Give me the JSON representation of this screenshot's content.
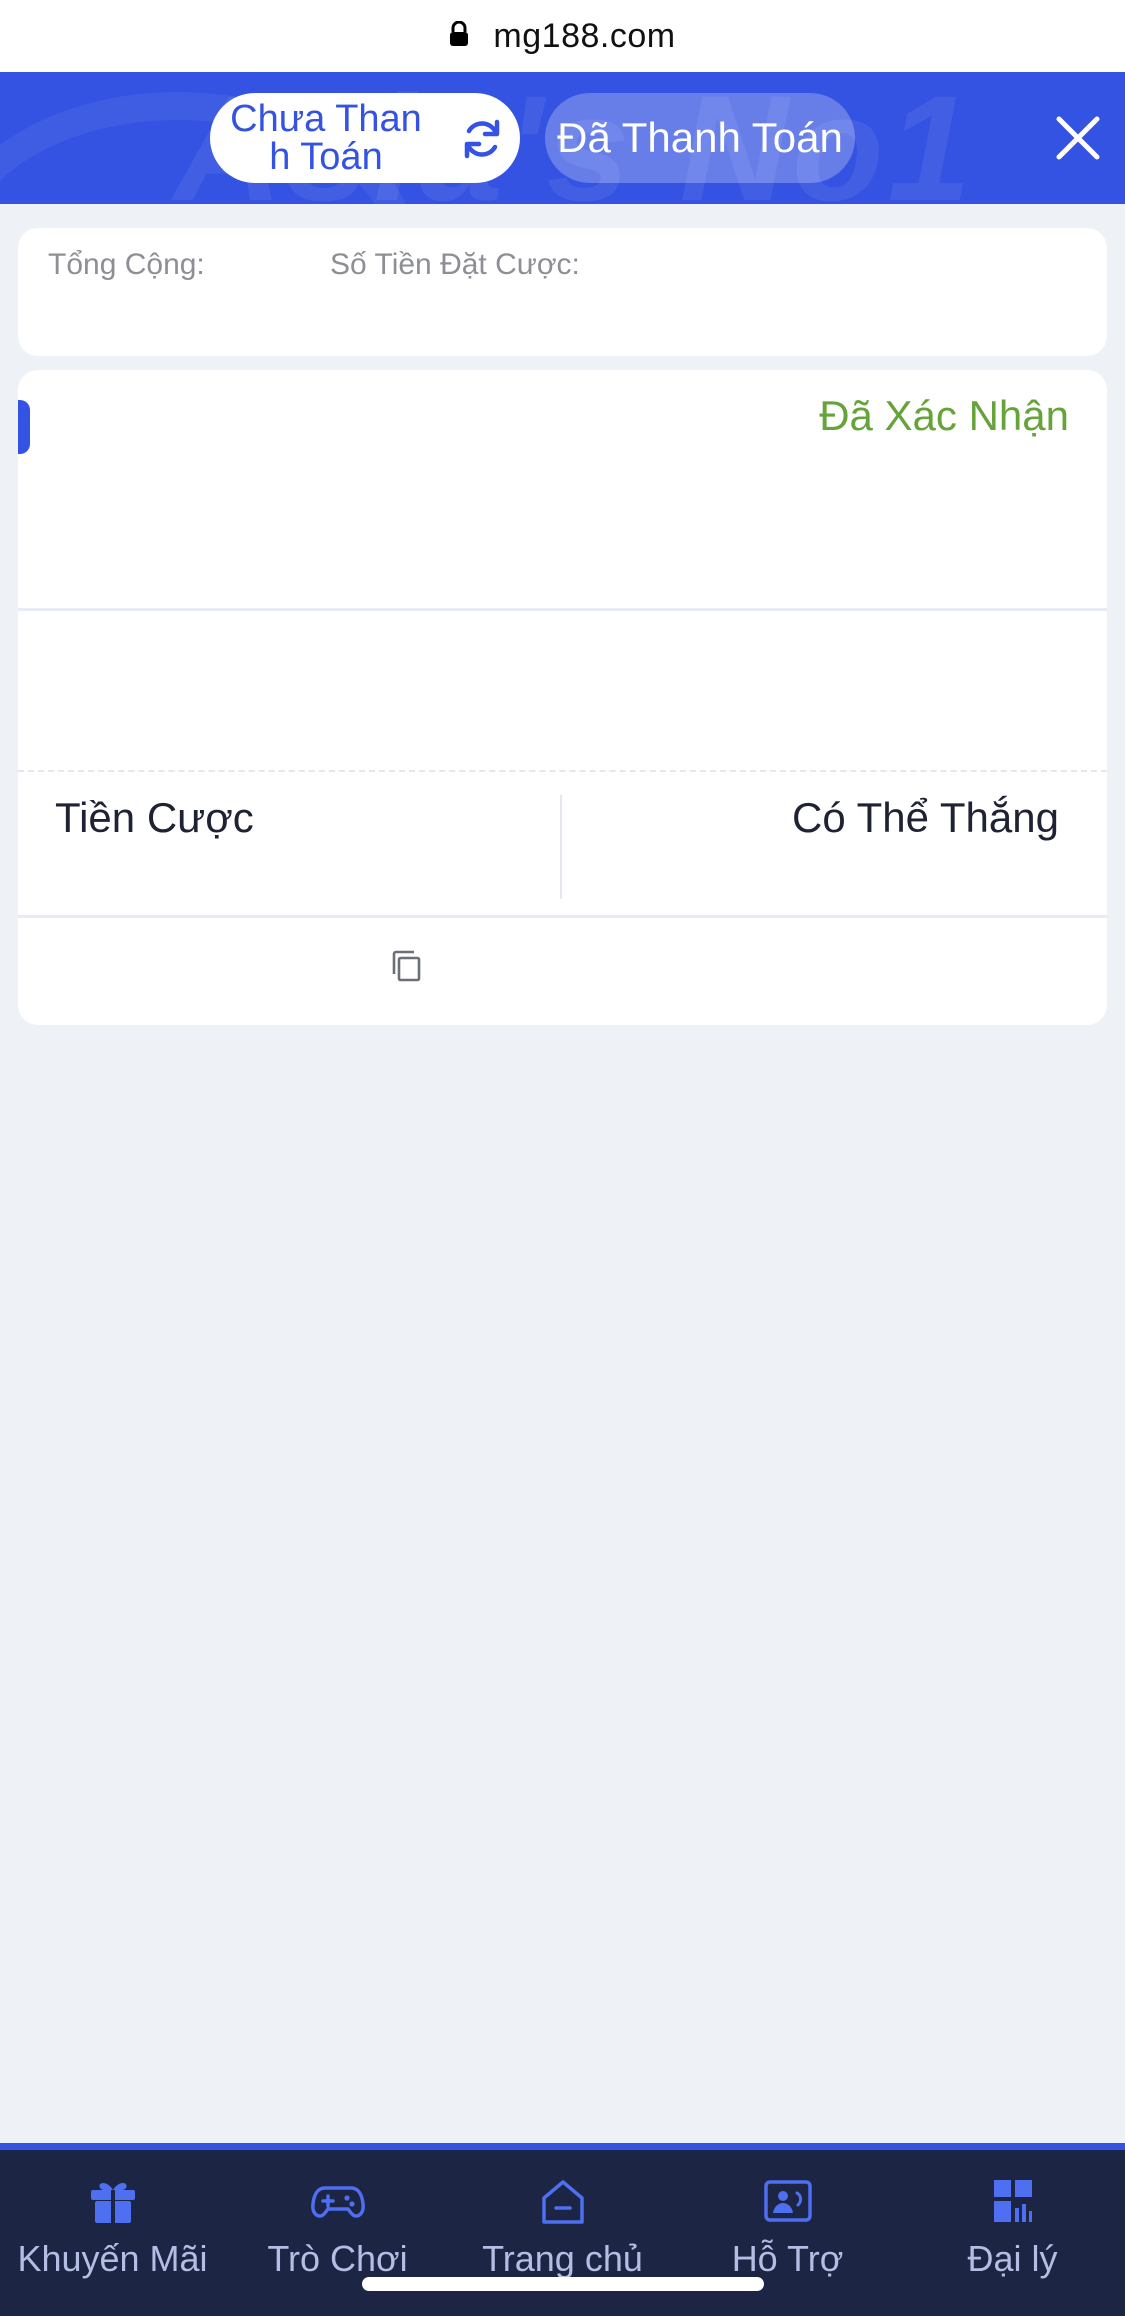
{
  "browser": {
    "url": "mg188.com"
  },
  "header": {
    "tab_unpaid": "Chưa Thanh Toán",
    "tab_paid": "Đã Thanh Toán",
    "decor_text": "Asia's No1",
    "accent_color": "#3453e2"
  },
  "summary": {
    "total_label": "Tổng Cộng:",
    "stake_label": "Số Tiền Đặt Cược:"
  },
  "bet": {
    "status": "Đã Xác Nhận",
    "status_color": "#66a33a",
    "stake_label": "Tiền Cược",
    "win_label": "Có Thể Thắng",
    "copy_icon": "copy-icon"
  },
  "nav": {
    "items": [
      {
        "label": "Khuyến Mãi",
        "icon": "gift-icon"
      },
      {
        "label": "Trò Chơi",
        "icon": "gamepad-icon"
      },
      {
        "label": "Trang chủ",
        "icon": "home-icon"
      },
      {
        "label": "Hỗ Trợ",
        "icon": "support-icon"
      },
      {
        "label": "Đại lý",
        "icon": "agent-icon"
      }
    ],
    "background": "#1d2544"
  }
}
